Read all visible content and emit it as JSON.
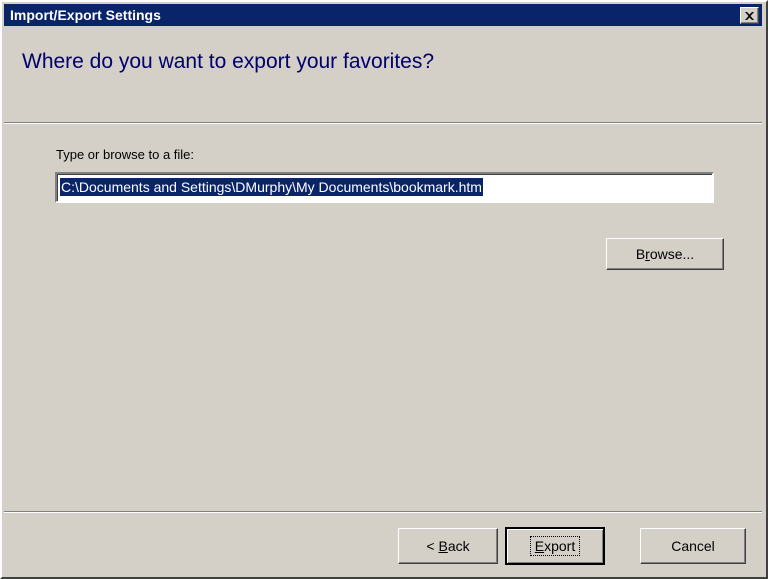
{
  "window": {
    "title": "Import/Export Settings",
    "close_icon": "close-x-icon"
  },
  "header": {
    "title": "Where do you want to export your favorites?"
  },
  "file_field": {
    "label": "Type or browse to a file:",
    "value": "C:\\Documents and Settings\\DMurphy\\My Documents\\bookmark.htm"
  },
  "buttons": {
    "browse": {
      "accel": "r",
      "pre": "B",
      "post": "owse..."
    },
    "back": {
      "pre": "< ",
      "accel": "B",
      "post": "ack"
    },
    "export": {
      "pre": "",
      "accel": "E",
      "post": "xport"
    },
    "cancel": {
      "label": "Cancel"
    }
  },
  "colors": {
    "titlebar": "#0a246a",
    "face": "#d4d0c8",
    "header_text": "#00006a",
    "selection": "#0a246a"
  }
}
